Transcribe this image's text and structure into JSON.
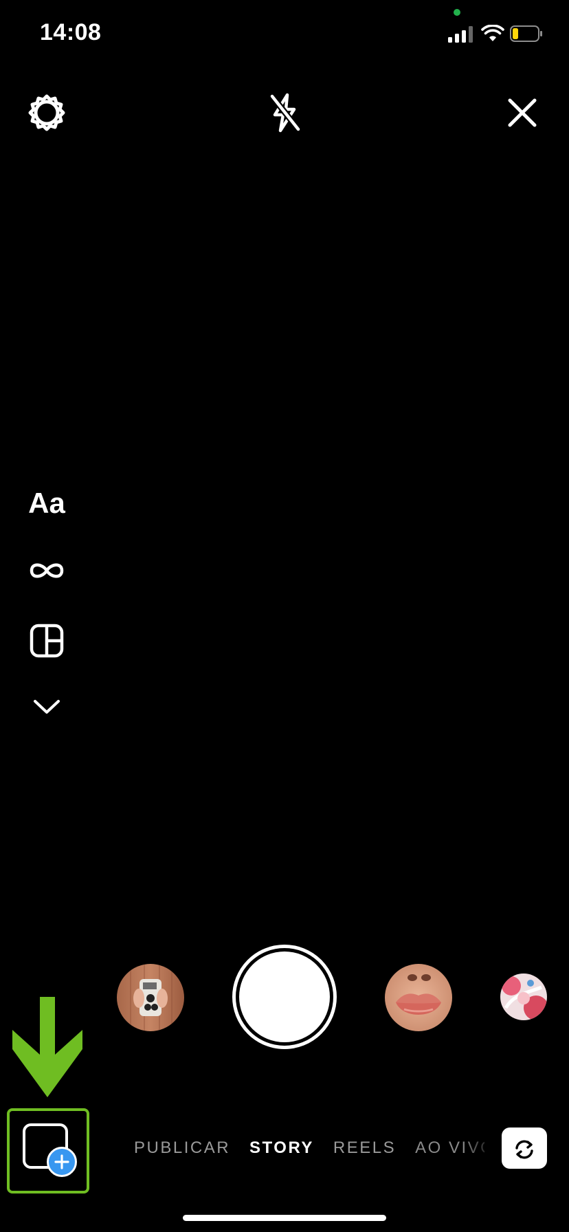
{
  "status_bar": {
    "time": "14:08",
    "privacy_dot_color": "#22b14c",
    "battery_fill_color": "#ffd60a"
  },
  "top_bar": {
    "icons": [
      "settings-gear-icon",
      "flash-off-icon",
      "close-icon"
    ]
  },
  "left_tools": {
    "text_tool_label": "Aa",
    "icons": [
      "boomerang-infinity-icon",
      "layout-grid-icon",
      "chevron-down-icon"
    ]
  },
  "capture_row": {
    "thumbnails": [
      "camera-phone-effect",
      "lips-effect",
      "pink-character-effect"
    ]
  },
  "modes": {
    "items": [
      "PUBLICAR",
      "STORY",
      "REELS",
      "AO VIVO"
    ],
    "active": "STORY"
  },
  "annotation": {
    "arrow_color": "#6fbd22",
    "highlight_color": "#6fbd22"
  },
  "colors": {
    "background": "#000000",
    "accent_blue": "#3897f0"
  }
}
